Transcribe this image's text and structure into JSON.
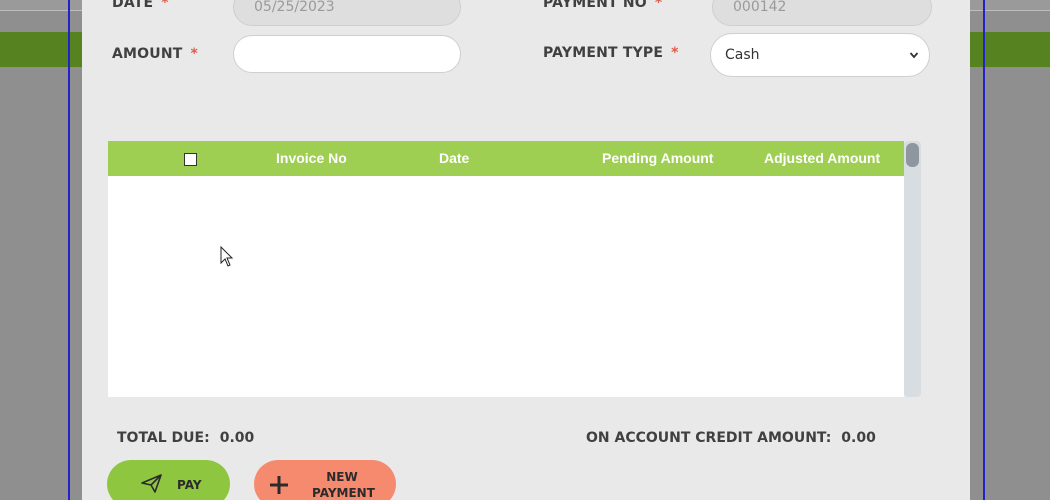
{
  "form": {
    "date_label": "DATE",
    "date_value": "05/25/2023",
    "payment_no_label": "PAYMENT NO",
    "payment_no_value": "000142",
    "amount_label": "AMOUNT",
    "amount_value": "",
    "payment_type_label": "PAYMENT TYPE",
    "payment_type_value": "Cash",
    "required_mark": "*"
  },
  "table": {
    "columns": [
      "Invoice No",
      "Date",
      "Pending Amount",
      "Adjusted Amount"
    ],
    "rows": []
  },
  "summary": {
    "total_due_label": "TOTAL DUE:",
    "total_due_value": "0.00",
    "credit_label": "ON ACCOUNT CREDIT AMOUNT:",
    "credit_value": "0.00"
  },
  "buttons": {
    "pay_label": "PAY",
    "new_payment_line1": "NEW",
    "new_payment_line2": "PAYMENT"
  },
  "colors": {
    "accent_green": "#9ecf52",
    "pay_button": "#8fc63f",
    "new_payment_button": "#f58a6e",
    "required": "#e05c4a"
  },
  "icons": {
    "pay": "paper-plane-icon",
    "new_payment": "plus-icon",
    "select": "chevron-down-icon"
  }
}
